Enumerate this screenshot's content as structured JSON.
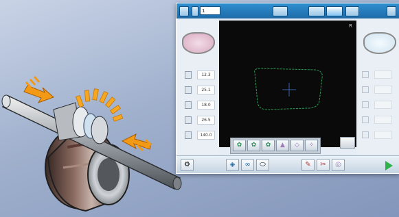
{
  "screen": {
    "top_field": "1",
    "lens_params": [
      "12.3",
      "25.1",
      "18.0",
      "26.5",
      "140.0"
    ],
    "corner_mark": "R"
  },
  "colors": {
    "accent": "#1e6aa8",
    "display_bg": "#0a0a0a",
    "shape_outline": "#2e9a52",
    "crosshair": "#3c5fa8"
  },
  "icons": {
    "tool_row": [
      "tool-a-icon",
      "tool-b-icon",
      "tool-c-icon",
      "tool-d-icon",
      "tool-e-icon",
      "tool-f-icon"
    ],
    "bottom": [
      "settings-icon",
      "diamond-icon",
      "link-icon",
      "shape-icon",
      "pen-icon",
      "scissor-icon",
      "circle-icon",
      "play-icon"
    ]
  }
}
